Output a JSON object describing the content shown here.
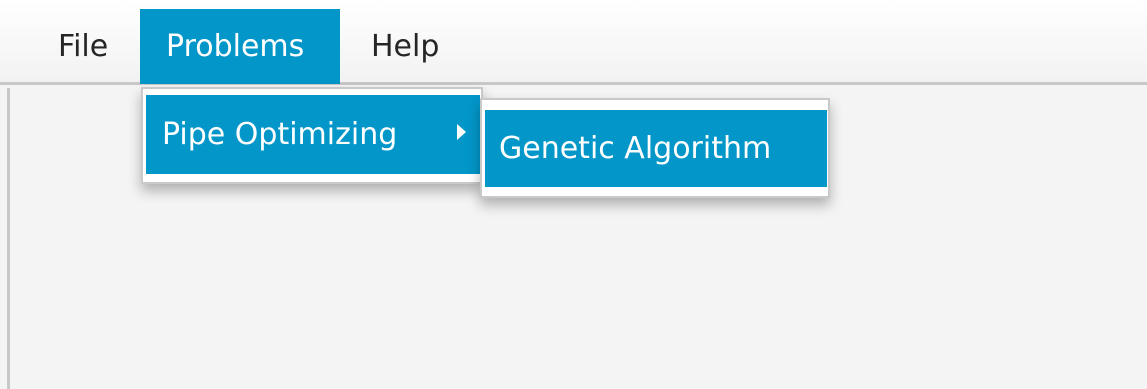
{
  "menubar": {
    "items": [
      {
        "label": "File"
      },
      {
        "label": "Problems",
        "active": true
      },
      {
        "label": "Help"
      }
    ]
  },
  "problems_menu": {
    "items": [
      {
        "label": "Pipe Optimizing",
        "has_submenu": true,
        "submenu_icon": "chevron-right-icon"
      }
    ]
  },
  "pipe_optimizing_submenu": {
    "items": [
      {
        "label": "Genetic Algorithm"
      }
    ]
  },
  "colors": {
    "accent": "#0396c8",
    "menubar_bg": "#f2f2f2",
    "content_bg": "#f4f4f4"
  }
}
